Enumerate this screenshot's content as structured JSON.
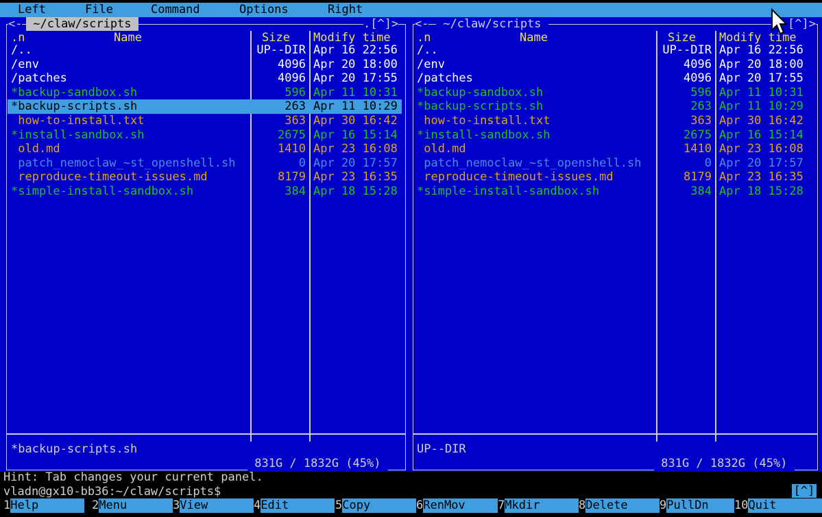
{
  "menubar": {
    "items": [
      "Left",
      "File",
      "Command",
      "Options",
      "Right"
    ]
  },
  "left_panel": {
    "title": " ~/claw/scripts ",
    "corner_left": "<-",
    "corner_right": ".[^]>",
    "headers": {
      "n": ".n",
      "name": "Name",
      "size": "Size",
      "time": "Modify time"
    },
    "files": [
      {
        "name": "/..",
        "size": "UP--DIR",
        "time": "Apr 16 22:56",
        "type": "dir"
      },
      {
        "name": "/env",
        "size": "4096",
        "time": "Apr 20 18:00",
        "type": "dir"
      },
      {
        "name": "/patches",
        "size": "4096",
        "time": "Apr 20 17:55",
        "type": "dir"
      },
      {
        "name": "*backup-sandbox.sh",
        "size": "596",
        "time": "Apr 11 10:31",
        "type": "exec"
      },
      {
        "name": "*backup-scripts.sh",
        "size": "263",
        "time": "Apr 11 10:29",
        "type": "exec",
        "selected": true
      },
      {
        "name": " how-to-install.txt",
        "size": "363",
        "time": "Apr 30 16:42",
        "type": "doc"
      },
      {
        "name": "*install-sandbox.sh",
        "size": "2675",
        "time": "Apr 16 15:14",
        "type": "exec"
      },
      {
        "name": " old.md",
        "size": "1410",
        "time": "Apr 23 16:08",
        "type": "doc"
      },
      {
        "name": " patch_nemoclaw_~st_openshell.sh",
        "size": "0",
        "time": "Apr 20 17:57",
        "type": "dim"
      },
      {
        "name": " reproduce-timeout-issues.md",
        "size": "8179",
        "time": "Apr 23 16:35",
        "type": "doc"
      },
      {
        "name": "*simple-install-sandbox.sh",
        "size": "384",
        "time": "Apr 18 15:28",
        "type": "exec"
      }
    ],
    "status": "*backup-scripts.sh",
    "disk": " 831G / 1832G (45%) "
  },
  "right_panel": {
    "title": " ~/claw/scripts ",
    "corner_left": "<-",
    "corner_right": "[^]>",
    "headers": {
      "n": ".n",
      "name": "Name",
      "size": "Size",
      "time": "Modify time"
    },
    "files": [
      {
        "name": "/..",
        "size": "UP--DIR",
        "time": "Apr 16 22:56",
        "type": "dir"
      },
      {
        "name": "/env",
        "size": "4096",
        "time": "Apr 20 18:00",
        "type": "dir"
      },
      {
        "name": "/patches",
        "size": "4096",
        "time": "Apr 20 17:55",
        "type": "dir"
      },
      {
        "name": "*backup-sandbox.sh",
        "size": "596",
        "time": "Apr 11 10:31",
        "type": "exec"
      },
      {
        "name": "*backup-scripts.sh",
        "size": "263",
        "time": "Apr 11 10:29",
        "type": "exec"
      },
      {
        "name": " how-to-install.txt",
        "size": "363",
        "time": "Apr 30 16:42",
        "type": "doc"
      },
      {
        "name": "*install-sandbox.sh",
        "size": "2675",
        "time": "Apr 16 15:14",
        "type": "exec"
      },
      {
        "name": " old.md",
        "size": "1410",
        "time": "Apr 23 16:08",
        "type": "doc"
      },
      {
        "name": " patch_nemoclaw_~st_openshell.sh",
        "size": "0",
        "time": "Apr 20 17:57",
        "type": "dim"
      },
      {
        "name": " reproduce-timeout-issues.md",
        "size": "8179",
        "time": "Apr 23 16:35",
        "type": "doc"
      },
      {
        "name": "*simple-install-sandbox.sh",
        "size": "384",
        "time": "Apr 18 15:28",
        "type": "exec"
      }
    ],
    "status": "UP--DIR",
    "disk": " 831G / 1832G (45%) "
  },
  "hint": "Hint: Tab changes your current panel.",
  "prompt": "vladn@gx10-bb36:~/claw/scripts$",
  "prompt_indicator": "[^]",
  "fkeys": [
    {
      "num": "1",
      "label": "Help"
    },
    {
      "num": "2",
      "label": "Menu"
    },
    {
      "num": "3",
      "label": "View"
    },
    {
      "num": "4",
      "label": "Edit"
    },
    {
      "num": "5",
      "label": "Copy"
    },
    {
      "num": "6",
      "label": "RenMov"
    },
    {
      "num": "7",
      "label": "Mkdir"
    },
    {
      "num": "8",
      "label": "Delete"
    },
    {
      "num": "9",
      "label": "PullDn"
    },
    {
      "num": "10",
      "label": "Quit"
    }
  ],
  "colors": {
    "panel_bg": "#0000c8",
    "accent": "#3f9ee0",
    "exec": "#22c022",
    "doc": "#e0a020",
    "dim": "#4a8ce0",
    "dir": "#ffffff"
  },
  "icons": {
    "mouse": "mouse-pointer-icon"
  }
}
